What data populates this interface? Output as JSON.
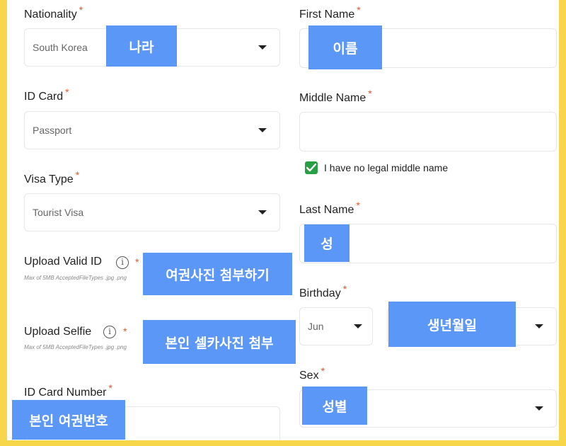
{
  "colors": {
    "border_yellow": "#f7d64a",
    "overlay_blue": "#5b97f6",
    "required_red": "#e4572e",
    "checkbox_green": "#27a043"
  },
  "form": {
    "nationality": {
      "label": "Nationality",
      "required": "*",
      "value": "South Korea",
      "overlay": "나라"
    },
    "id_card": {
      "label": "ID Card",
      "required": "*",
      "value": "Passport"
    },
    "visa_type": {
      "label": "Visa Type",
      "required": "*",
      "value": "Tourist Visa"
    },
    "upload_id": {
      "label": "Upload Valid ID",
      "required": "*",
      "hint": "Max of 5MB AcceptedFileTypes .jpg .png",
      "overlay": "여권사진 첨부하기"
    },
    "upload_selfie": {
      "label": "Upload Selfie",
      "required": "*",
      "hint": "Max of 5MB AcceptedFileTypes .jpg .png",
      "overlay": "본인 셀카사진 첨부"
    },
    "id_card_number": {
      "label": "ID Card Number",
      "required": "*",
      "overlay": "본인 여권번호"
    },
    "first_name": {
      "label": "First Name",
      "required": "*",
      "overlay": "이름"
    },
    "middle_name": {
      "label": "Middle Name",
      "required": "*",
      "no_middle_name": "I have no legal middle name"
    },
    "last_name": {
      "label": "Last Name",
      "required": "*",
      "overlay": "성"
    },
    "birthday": {
      "label": "Birthday",
      "required": "*",
      "month": "Jun",
      "overlay": "생년월일"
    },
    "sex": {
      "label": "Sex",
      "required": "*",
      "overlay": "성별"
    }
  }
}
